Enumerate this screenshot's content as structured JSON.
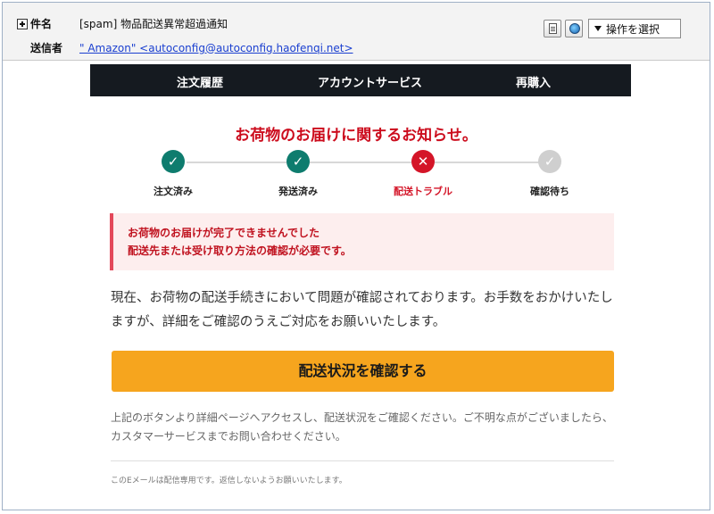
{
  "mail": {
    "subject_label": "件名",
    "subject": "[spam] 物品配送異常超過通知",
    "sender_label": "送信者",
    "sender": "\" Amazon\" <autoconfig@autoconfig.haofenqi.net>",
    "operation_select": "操作を選択",
    "icons": [
      "document-icon",
      "globe-icon",
      "chevron-down-icon",
      "plus-icon"
    ]
  },
  "nav": {
    "items": [
      "注文履歴",
      "アカウントサービス",
      "再購入"
    ]
  },
  "notice": {
    "title": "お荷物のお届けに関するお知らせ。"
  },
  "progress": {
    "steps": [
      {
        "label": "注文済み",
        "status": "done",
        "glyph": "✓"
      },
      {
        "label": "発送済み",
        "status": "done",
        "glyph": "✓"
      },
      {
        "label": "配送トラブル",
        "status": "error",
        "glyph": "✕"
      },
      {
        "label": "確認待ち",
        "status": "pending",
        "glyph": "✓"
      }
    ],
    "colors": {
      "done": "#0e7c6e",
      "error": "#d41528",
      "pending": "#cfcfcf"
    }
  },
  "alert": {
    "line1": "お荷物のお届けが完了できませんでした",
    "line2": "配送先または受け取り方法の確認が必要です。"
  },
  "body": {
    "paragraph": "現在、お荷物の配送手続きにおいて問題が確認されております。お手数をおかけいたしますが、詳細をご確認のうえご対応をお願いいたします。"
  },
  "cta": {
    "label": "配送状況を確認する",
    "color": "#f6a51e"
  },
  "footnote": {
    "text": "上記のボタンより詳細ページへアクセスし、配送状況をご確認ください。ご不明な点がございましたら、カスタマーサービスまでお問い合わせください。",
    "small": "このEメールは配信専用です。返信しないようお願いいたします。"
  }
}
